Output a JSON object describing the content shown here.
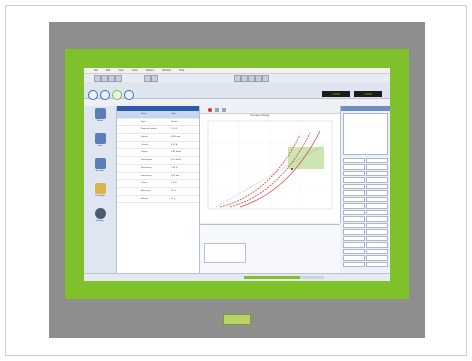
{
  "brand": {
    "logo_text": "maxon"
  },
  "app": {
    "menu": [
      "File",
      "Edit",
      "View",
      "Tools",
      "Options",
      "Window",
      "Help"
    ],
    "readouts": [
      "0.0000",
      "0.0000"
    ],
    "sidebar_items": [
      "Motor",
      "Gear",
      "Encoder",
      "Controller",
      "Settings"
    ],
    "table_rows": [
      [
        "",
        "Name",
        "Value"
      ],
      [
        "",
        "Type",
        "Param"
      ],
      [
        "",
        "Nominal voltage",
        "12.0 V"
      ],
      [
        "",
        "Speed",
        "4390 rpm"
      ],
      [
        "",
        "Current",
        "0.57 A"
      ],
      [
        "",
        "Torque",
        "5.83 mNm"
      ],
      [
        "",
        "Stall torque",
        "65.0 mNm"
      ],
      [
        "",
        "Resistance",
        "7.84 Ω"
      ],
      [
        "",
        "Inductance",
        "0.39 mH"
      ],
      [
        "",
        "Power",
        "3.0 W"
      ],
      [
        "",
        "Efficiency",
        "78 %"
      ],
      [
        "",
        "Weight",
        "21 g"
      ]
    ],
    "plot": {
      "title": "Operating Range"
    },
    "right_panel_rows": [
      [
        "",
        ""
      ],
      [
        "",
        ""
      ],
      [
        "",
        ""
      ],
      [
        "",
        ""
      ],
      [
        "",
        ""
      ],
      [
        "",
        ""
      ],
      [
        "",
        ""
      ],
      [
        "",
        ""
      ],
      [
        "",
        ""
      ],
      [
        "",
        ""
      ],
      [
        "",
        ""
      ],
      [
        "",
        ""
      ],
      [
        "",
        ""
      ],
      [
        "",
        ""
      ],
      [
        "",
        ""
      ],
      [
        "",
        ""
      ],
      [
        "",
        ""
      ]
    ],
    "bottom_text": [
      "",
      "",
      "",
      ""
    ],
    "progress_fraction": 0.7
  },
  "colors": {
    "bezel": "#7ec12b",
    "device": "#8e8e8e",
    "accent": "#2e5aa8"
  }
}
